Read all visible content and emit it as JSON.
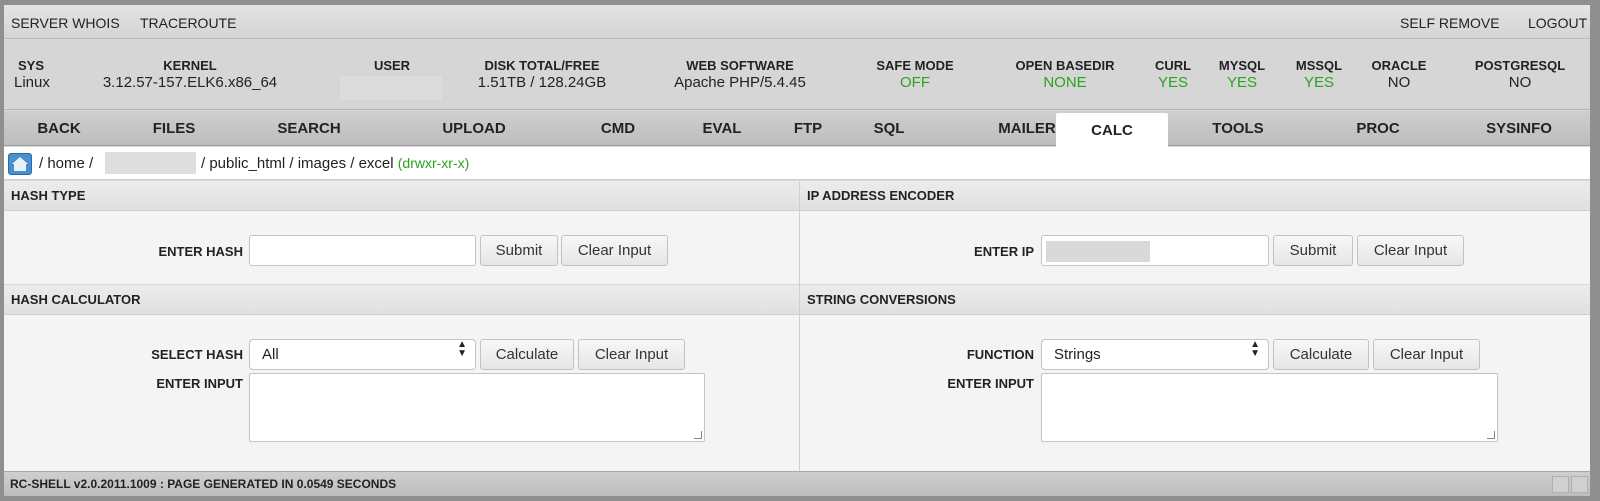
{
  "topbar": {
    "left_links": [
      "SERVER WHOIS",
      "TRACEROUTE"
    ],
    "right_links": [
      "SELF REMOVE",
      "LOGOUT"
    ]
  },
  "info": {
    "sys": {
      "h": "SYS",
      "v": "Linux"
    },
    "kernel": {
      "h": "KERNEL",
      "v": "3.12.57-157.ELK6.x86_64"
    },
    "user": {
      "h": "USER"
    },
    "disk": {
      "h": "DISK TOTAL/FREE",
      "v": "1.51TB / 128.24GB"
    },
    "web": {
      "h": "WEB SOFTWARE",
      "v": "Apache PHP/5.4.45"
    },
    "safe": {
      "h": "SAFE MODE",
      "v": "OFF"
    },
    "basedir": {
      "h": "OPEN BASEDIR",
      "v": "NONE"
    },
    "curl": {
      "h": "CURL",
      "v": "YES"
    },
    "mysql": {
      "h": "MYSQL",
      "v": "YES"
    },
    "mssql": {
      "h": "MSSQL",
      "v": "YES"
    },
    "oracle": {
      "h": "ORACLE",
      "v": "NO"
    },
    "postgres": {
      "h": "POSTGRESQL",
      "v": "NO"
    },
    "status_colors": {
      "positive": "#2aa31f"
    }
  },
  "tabs": [
    "BACK",
    "FILES",
    "SEARCH",
    "UPLOAD",
    "CMD",
    "EVAL",
    "FTP",
    "SQL",
    "MAILERS",
    "CALC",
    "TOOLS",
    "PROC",
    "SYSINFO"
  ],
  "active_tab": "CALC",
  "breadcrumb": {
    "icon": "home-icon",
    "p1": "/ home /",
    "p2": "/ public_html / images / excel",
    "perm": "(drwxr-xr-x)"
  },
  "hash_type": {
    "title": "HASH TYPE",
    "label": "ENTER HASH",
    "value": "",
    "submit": "Submit",
    "clear": "Clear Input"
  },
  "ip_encoder": {
    "title": "IP ADDRESS ENCODER",
    "label": "ENTER IP",
    "submit": "Submit",
    "clear": "Clear Input"
  },
  "hash_calc": {
    "title": "HASH CALCULATOR",
    "select_label": "SELECT HASH",
    "select_value": "All",
    "calculate": "Calculate",
    "clear": "Clear Input",
    "input_label": "ENTER INPUT"
  },
  "string_conv": {
    "title": "STRING CONVERSIONS",
    "select_label": "FUNCTION",
    "select_value": "Strings",
    "calculate": "Calculate",
    "clear": "Clear Input",
    "input_label": "ENTER INPUT"
  },
  "footer": {
    "text": "RC-SHELL v2.0.2011.1009 : PAGE GENERATED IN 0.0549 SECONDS"
  }
}
